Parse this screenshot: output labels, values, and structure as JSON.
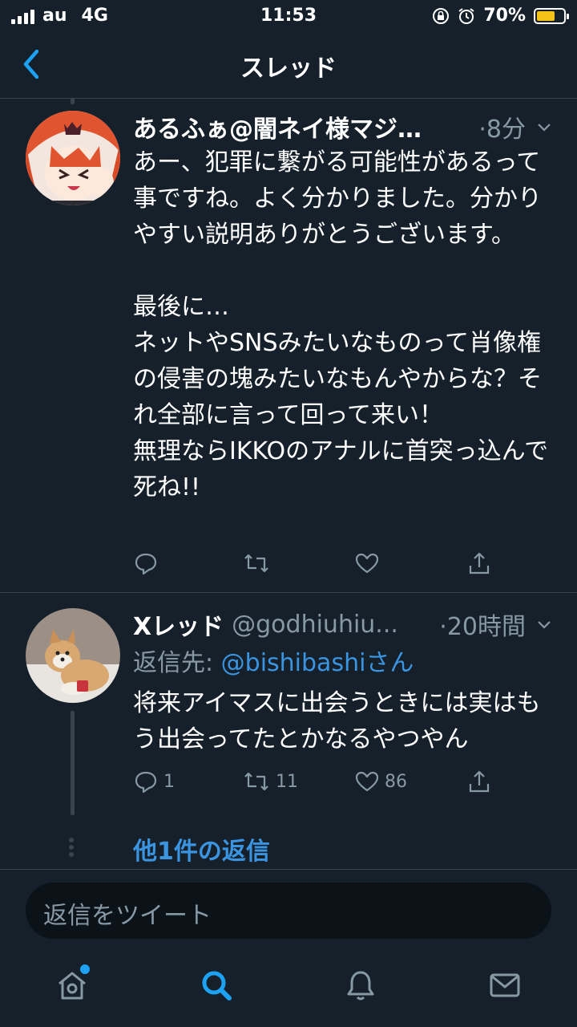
{
  "status_bar": {
    "carrier": "au",
    "network": "4G",
    "time": "11:53",
    "battery_percent": "70%",
    "battery_level": 0.7
  },
  "header": {
    "title": "スレッド"
  },
  "tweets": [
    {
      "name": "あるふぁ@闇ネイ様マジ…",
      "time": "·8分",
      "text": "あー、犯罪に繋がる可能性があるって事ですね。よく分かりました。分かりやすい説明ありがとうございます。\n\n最後に…\nネットやSNSみたいなものって肖像権の侵害の塊みたいなもんやからな？それ全部に言って回って来い！\n無理ならIKKOのアナルに首突っ込んで死ね!!"
    },
    {
      "name": "Xレッド",
      "handle": "@godhiuhiu...",
      "time": "·20時間",
      "reply_prefix": "返信先: ",
      "reply_to": "@bishibashiさん",
      "text": "将来アイマスに出会うときには実はもう出会ってたとかなるやつやん",
      "replies": "1",
      "retweets": "11",
      "likes": "86"
    }
  ],
  "more_replies": "他1件の返信",
  "composer": {
    "placeholder": "返信をツイート"
  },
  "tab_bar": {
    "items": [
      "home-icon",
      "search-icon",
      "notifications-icon",
      "messages-icon"
    ],
    "active": "search-icon"
  },
  "colors": {
    "background": "#15202b",
    "accent": "#1da1f2",
    "link": "#3b94e0",
    "secondary_text": "#8899a6",
    "battery": "#f4c21b"
  }
}
